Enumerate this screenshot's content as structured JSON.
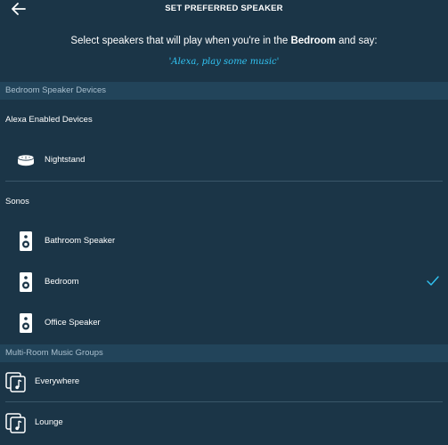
{
  "header": {
    "title": "SET PREFERRED SPEAKER",
    "back_icon": "arrow-left-icon"
  },
  "intro": {
    "before": "Select speakers that will play when you're in the ",
    "room": "Bedroom",
    "after": " and say:",
    "phrase": "'Alexa, play some music'"
  },
  "section_devices": {
    "title": "Bedroom Speaker Devices",
    "groups": [
      {
        "label": "Alexa Enabled Devices",
        "items": [
          {
            "label": "Nightstand",
            "icon": "echo-dot-icon",
            "selected": false
          }
        ]
      },
      {
        "label": "Sonos",
        "items": [
          {
            "label": "Bathroom Speaker",
            "icon": "speaker-icon",
            "selected": false
          },
          {
            "label": "Bedroom",
            "icon": "speaker-icon",
            "selected": true
          },
          {
            "label": "Office Speaker",
            "icon": "speaker-icon",
            "selected": false
          }
        ]
      }
    ]
  },
  "section_groups": {
    "title": "Multi-Room Music Groups",
    "items": [
      {
        "label": "Everywhere",
        "icon": "music-group-icon"
      },
      {
        "label": "Lounge",
        "icon": "music-group-icon"
      }
    ]
  },
  "colors": {
    "background": "#1b3547",
    "section_bar": "#22445a",
    "accent": "#31c4f3"
  }
}
